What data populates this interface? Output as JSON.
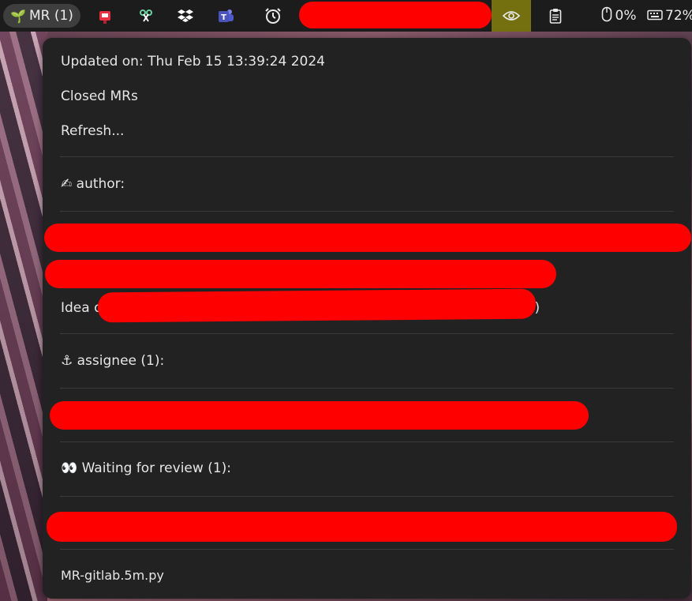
{
  "topbar": {
    "mr_indicator_label": "MR (1)",
    "sprout_glyph": "🌱",
    "mouse_battery": "0%",
    "keyboard_battery": "72%",
    "icons": [
      "mailbox-icon",
      "scissors-icon",
      "dropbox-icon",
      "teams-icon",
      "alarm-clock-icon",
      "eye-icon",
      "clipboard-icon",
      "mouse-icon",
      "keyboard-icon"
    ]
  },
  "menu": {
    "updated_on": "Updated on: Thu Feb 15 13:39:24 2024",
    "closed_mrs": "Closed MRs",
    "refresh": "Refresh...",
    "author_header": "✍ author:",
    "author_item_3_prefix": "Idea o",
    "author_item_3_suffix": ")",
    "assignee_header": "⚓ assignee (1):",
    "review_header": "👀 Waiting for review (1):",
    "footer": "MR-gitlab.5m.py"
  },
  "colors": {
    "redaction": "#ff0000",
    "menu_bg": "#222222",
    "topbar_bg": "#1c1c1c",
    "active_indicator": "#74700f"
  }
}
